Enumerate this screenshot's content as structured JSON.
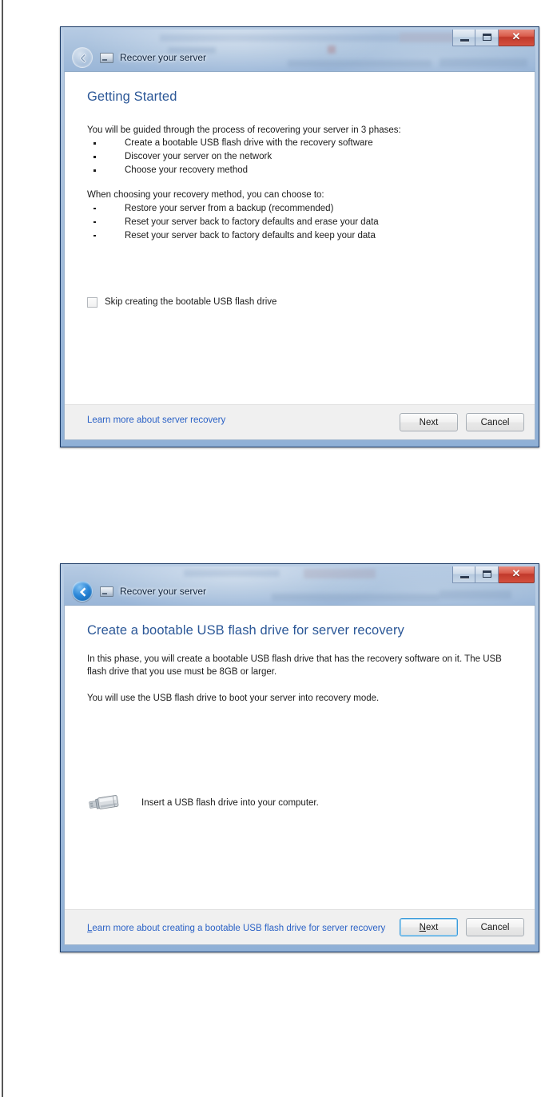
{
  "dialogs": [
    {
      "window_title": "Recover your server",
      "back_enabled": false,
      "caption": {
        "minimize": "Minimize",
        "maximize": "Maximize",
        "close": "✕"
      },
      "heading": "Getting Started",
      "intro": "You will be guided through the process  of recovering your server in 3 phases:",
      "phases": [
        "Create a bootable USB flash drive with the recovery software",
        "Discover your server on the network",
        "Choose your recovery method"
      ],
      "methods_intro": "When choosing your recovery method, you can choose to:",
      "methods": [
        "Restore your server from a backup (recommended)",
        "Reset your server back to factory defaults and erase your data",
        "Reset your server back to factory defaults and keep your data"
      ],
      "checkbox": {
        "label": "Skip creating the bootable USB flash drive",
        "checked": false
      },
      "link": {
        "accel": "",
        "text": "Learn more about server recovery"
      },
      "buttons": {
        "next": {
          "accel": "",
          "text": "Next",
          "focused": false
        },
        "cancel": {
          "accel": "",
          "text": "Cancel",
          "focused": false
        }
      }
    },
    {
      "window_title": "Recover your server",
      "back_enabled": true,
      "caption": {
        "minimize": "Minimize",
        "maximize": "Maximize",
        "close": "✕"
      },
      "heading": "Create a bootable USB flash drive for server recovery",
      "paragraph1": "In this phase, you will create a bootable USB flash drive that has the recovery software on it. The USB flash drive that you use must be 8GB or larger.",
      "paragraph2": "You will use the USB flash drive to boot your server into recovery mode.",
      "usb_prompt": "Insert a USB flash drive into your computer.",
      "link": {
        "accel": "L",
        "text": "earn more about creating a bootable USB flash drive for server recovery"
      },
      "buttons": {
        "next": {
          "accel": "N",
          "text": "ext",
          "focused": true
        },
        "cancel": {
          "accel": "",
          "text": "Cancel",
          "focused": false
        }
      }
    }
  ],
  "colors": {
    "heading_blue": "#2b5797",
    "link_blue": "#2b62c6",
    "frame_blue": "#1b3a66",
    "close_red": "#c0392b",
    "footer_grey": "#f0f0f0"
  }
}
